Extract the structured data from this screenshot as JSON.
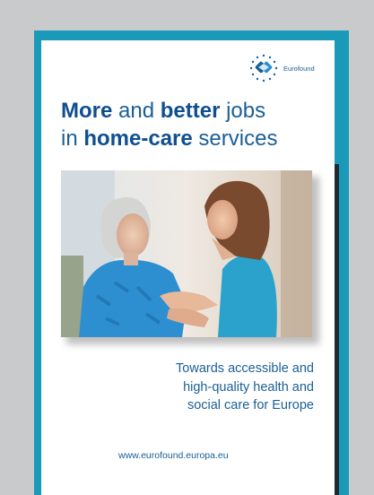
{
  "logo": {
    "name": "Eurofound",
    "icon": "eurofound-star-logo-icon"
  },
  "title": {
    "w1": "More",
    "w2": " and ",
    "w3": "better",
    "w4": " jobs",
    "w5": "in ",
    "w6": "home-care",
    "w7": " services"
  },
  "photo": {
    "icon": "caregiver-with-elderly-woman-photo"
  },
  "tagline": {
    "line1": "Towards accessible and",
    "line2": "high-quality health and",
    "line3": "social care for Europe"
  },
  "footer": {
    "url": "www.eurofound.europa.eu"
  },
  "colors": {
    "frame": "#1a9ab8",
    "text": "#1a5f96",
    "background": "#c9cacc"
  }
}
